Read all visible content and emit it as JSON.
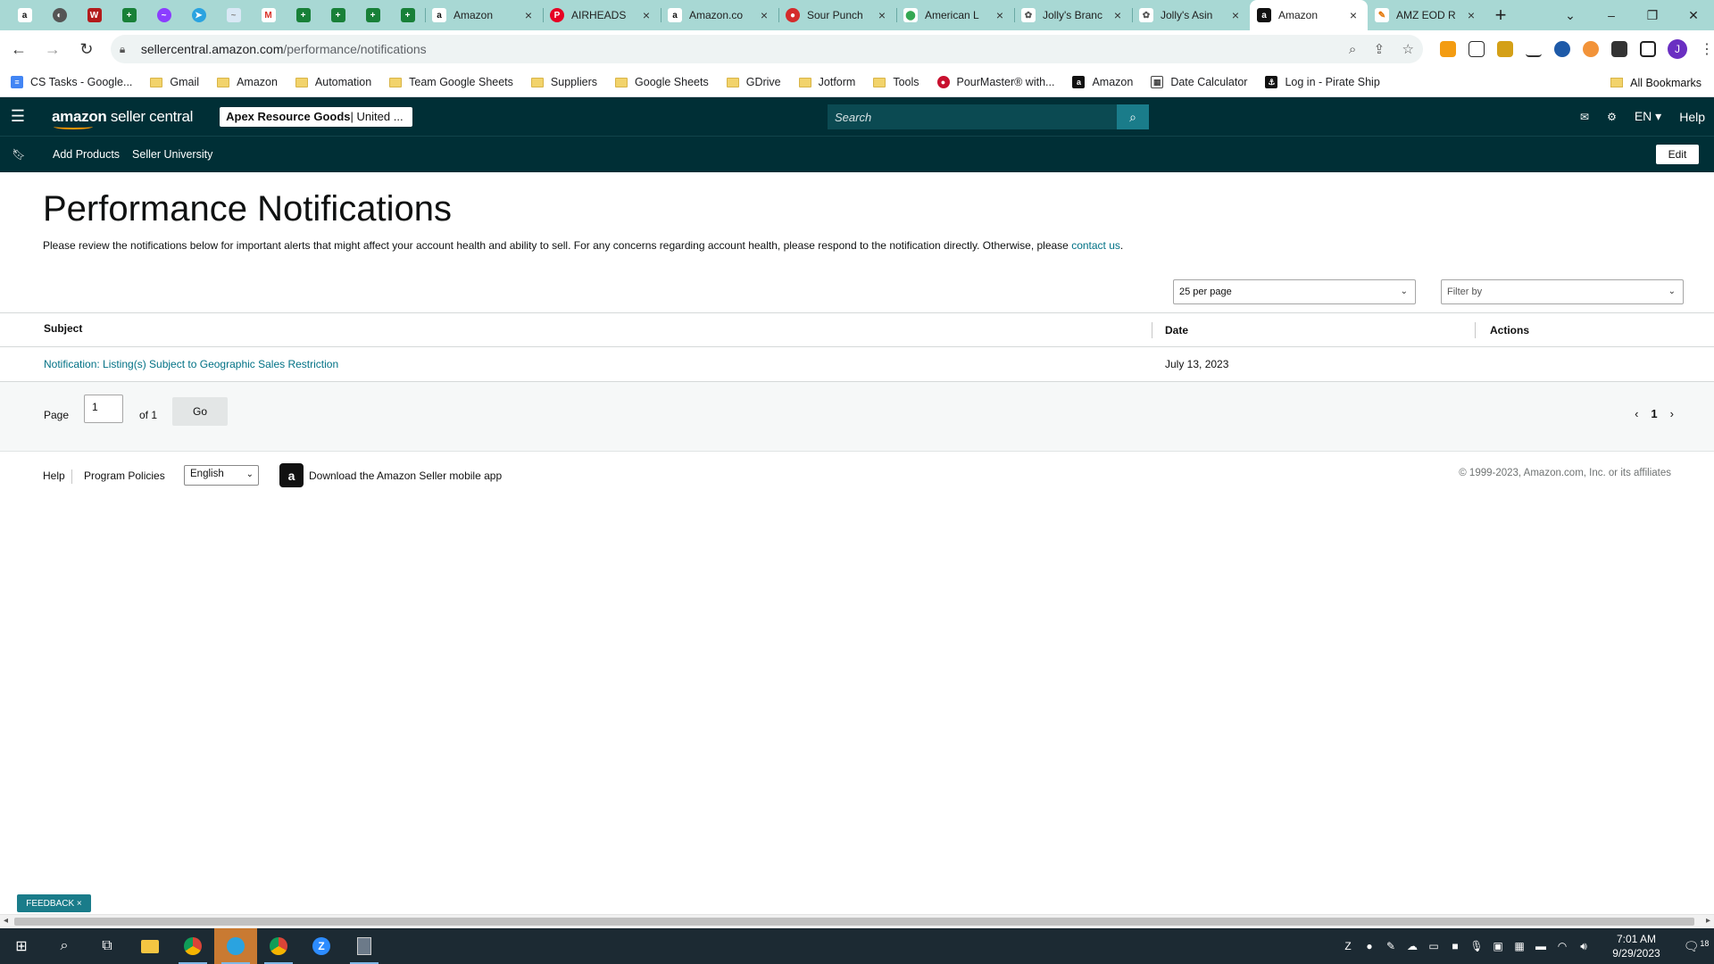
{
  "browser": {
    "pinned_tabs": [
      "amazon",
      "chrome",
      "w",
      "sheets",
      "messenger",
      "telegram",
      "bookmark",
      "gmail",
      "sheets",
      "sheets",
      "sheets",
      "sheets"
    ],
    "tabs": [
      {
        "title": "Amazon",
        "icon": "amazon-icon"
      },
      {
        "title": "AIRHEADS",
        "icon": "pinterest-icon"
      },
      {
        "title": "Amazon.co",
        "icon": "amazon-icon"
      },
      {
        "title": "Sour Punch",
        "icon": "sourpunch-icon"
      },
      {
        "title": "American L",
        "icon": "maps-icon"
      },
      {
        "title": "Jolly's Branc",
        "icon": "sellerapp-icon"
      },
      {
        "title": "Jolly's Asin",
        "icon": "sellerapp-icon"
      },
      {
        "title": "Amazon",
        "icon": "amazon-icon",
        "active": true
      },
      {
        "title": "AMZ EOD R",
        "icon": "amz-icon"
      }
    ],
    "url_host": "sellercentral.amazon.com",
    "url_path": "/performance/notifications",
    "profile_initial": "J",
    "bookmarks": [
      {
        "label": "CS Tasks - Google...",
        "type": "docs"
      },
      {
        "label": "Gmail",
        "type": "folder"
      },
      {
        "label": "Amazon",
        "type": "folder"
      },
      {
        "label": "Automation",
        "type": "folder"
      },
      {
        "label": "Team Google Sheets",
        "type": "folder"
      },
      {
        "label": "Suppliers",
        "type": "folder"
      },
      {
        "label": "Google Sheets",
        "type": "folder"
      },
      {
        "label": "GDrive",
        "type": "folder"
      },
      {
        "label": "Jotform",
        "type": "folder"
      },
      {
        "label": "Tools",
        "type": "folder"
      },
      {
        "label": "PourMaster® with...",
        "type": "site"
      },
      {
        "label": "Amazon",
        "type": "amazon"
      },
      {
        "label": "Date Calculator",
        "type": "calc"
      },
      {
        "label": "Log in - Pirate Ship",
        "type": "pirate"
      }
    ],
    "all_bookmarks": "All Bookmarks"
  },
  "header": {
    "logo_amazon": "amazon",
    "logo_sc": " seller central",
    "account_name": "Apex Resource Goods",
    "account_region": " | United ...",
    "search_placeholder": "Search",
    "lang": "EN ▾",
    "help": "Help"
  },
  "subnav": {
    "links": [
      "Add Products",
      "Seller University"
    ],
    "edit": "Edit"
  },
  "page": {
    "title": "Performance Notifications",
    "description": "Please review the notifications below for important alerts that might affect your account health and ability to sell. For any concerns regarding account health, please respond to the notification directly. Otherwise, please ",
    "contact_link": "contact us",
    "description_end": ".",
    "per_page": "25 per page",
    "filter": "Filter by"
  },
  "table": {
    "columns": [
      "Subject",
      "Date",
      "Actions"
    ],
    "rows": [
      {
        "subject": "Notification: Listing(s) Subject to Geographic Sales Restriction",
        "date": "July 13, 2023",
        "actions": ""
      }
    ]
  },
  "pagination": {
    "label": "Page",
    "value": "1",
    "of": "of 1",
    "go": "Go",
    "current": "1"
  },
  "footer": {
    "help": "Help",
    "policies": "Program Policies",
    "language": "English",
    "app": "Download the Amazon Seller mobile app",
    "copyright": "© 1999-2023, Amazon.com, Inc. or its affiliates"
  },
  "feedback": "FEEDBACK ×",
  "taskbar": {
    "time": "7:01 AM",
    "date": "9/29/2023",
    "notifications": "18"
  },
  "colors": {
    "header_bg": "#002f36",
    "link": "#007185",
    "search_btn": "#1a7c8a",
    "tabstrip": "#a8d8d4"
  }
}
